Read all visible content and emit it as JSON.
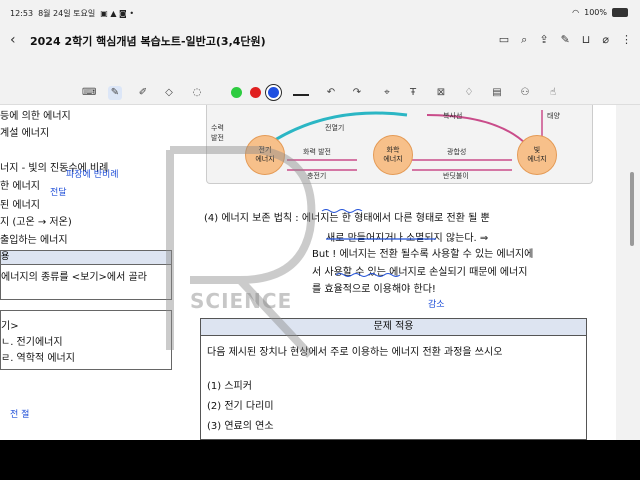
{
  "status": {
    "time": "12:53",
    "date": "8월 24일 토요일",
    "battery": "100%"
  },
  "title": "2024 2학기 핵심개념 복습노트-일반고(3,4단원)",
  "toolbar": {
    "colors": [
      "#2ecc40",
      "#e02020",
      "#2050e0"
    ]
  },
  "left_page": {
    "lines": [
      "등에 의한 에너지",
      "계설 에너지",
      "너지 - 빛의 진동수에 비례",
      "한 에너지",
      "된 에너지",
      "지 (고온 → 저온)",
      "출입하는 에너지"
    ],
    "box_head": "용",
    "box_line": "에너지의 종류를 <보기>에서 골라",
    "box2_lines": [
      "기>",
      "ㄴ. 전기에너지",
      "ㄹ. 역학적 에너지"
    ]
  },
  "handwriting": {
    "hw1": "파장에 반비례",
    "hw2": "전달",
    "hw3": "고온 → 저온",
    "hw4": "보존",
    "hw5": "감소",
    "hw6": "전 절"
  },
  "diagram": {
    "nodes": [
      "전기\n에너지",
      "화학\n에너지",
      "빛\n에너지"
    ],
    "labels": [
      "수력\n발전",
      "전열기",
      "화력 발전",
      "충전기",
      "광합성",
      "반딧불이",
      "복사선",
      "태양"
    ]
  },
  "content": {
    "law_line1": "(4) 에너지 보존 법칙 : 에너지는 한 형태에서 다른 형태로 전환 될 뿐",
    "law_line2": "새로 만들어지거나 소멸되지 않는다. ⇒",
    "but_line1": "But ! 에너지는 전환 될수록 사용할 수 있는 에너지에",
    "but_line2": "서 사용할 수 있는 에너지로 손실되기 때문에 에너지",
    "but_line3": "를 효율적으로 이용해야 한다!"
  },
  "problem": {
    "header": "문제 적용",
    "prompt": "다음 제시된 장치나 현상에서 주로 이용하는 에너지 전환 과정을 쓰시오",
    "items": [
      "(1) 스피커",
      "(2) 전기 다리미",
      "(3) 연료의 연소"
    ]
  },
  "watermark": {
    "text": "SCIENCE"
  }
}
